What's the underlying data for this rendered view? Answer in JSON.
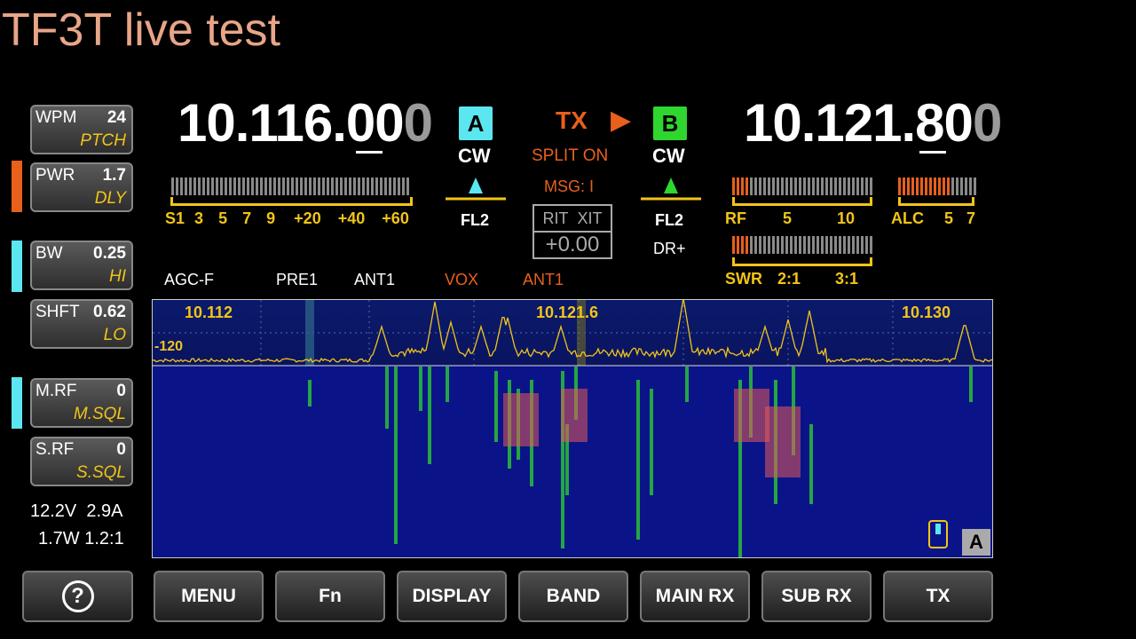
{
  "overlay_title": "TF3T live test",
  "left_panel": {
    "knobs": [
      {
        "label": "WPM",
        "value": "24",
        "sub": "PTCH"
      },
      {
        "label": "PWR",
        "value": "1.7",
        "sub": "DLY"
      },
      {
        "label": "BW",
        "value": "0.25",
        "sub": "HI"
      },
      {
        "label": "SHFT",
        "value": "0.62",
        "sub": "LO"
      },
      {
        "label": "M.RF",
        "value": "0",
        "sub": "M.SQL"
      },
      {
        "label": "S.RF",
        "value": "0",
        "sub": "S.SQL"
      }
    ],
    "indicator_colors": {
      "pwr": "#e8601c",
      "bw": "#5ce6f0",
      "mrf": "#5ce6f0"
    },
    "status_line1": "12.2V  2.9A",
    "status_line2": "1.7W 1.2:1"
  },
  "vfo_a": {
    "freq_main": "10.116.00",
    "freq_tail": "0",
    "badge": "A",
    "badge_color": "#5ce6f0",
    "mode": "CW",
    "filter": "FL2",
    "s_scale": [
      "S1",
      "3",
      "5",
      "7",
      "9",
      "+20",
      "+40",
      "+60"
    ]
  },
  "center": {
    "tx_label": "TX",
    "tx_arrow": "▶",
    "split": "SPLIT ON",
    "msg": "MSG: I",
    "rit": "RIT",
    "xit": "XIT",
    "offset": "+0.00",
    "dr": "DR+"
  },
  "vfo_b": {
    "freq_main": "10.121.80",
    "freq_tail": "0",
    "badge": "B",
    "badge_color": "#2fd62f",
    "mode": "CW",
    "filter": "FL2"
  },
  "meters": {
    "rf_scale": [
      "RF",
      "5",
      "10"
    ],
    "alc_scale": [
      "ALC",
      "5",
      "7"
    ],
    "swr_scale": [
      "SWR",
      "2:1",
      "3:1"
    ]
  },
  "status_row": {
    "agc": "AGC-F",
    "pre": "PRE1",
    "ant_rx": "ANT1",
    "vox": "VOX",
    "ant_tx": "ANT1"
  },
  "scope": {
    "left_freq": "10.112",
    "center_freq": "10.121.6",
    "right_freq": "10.130",
    "ref_level": "-120",
    "badge": "A"
  },
  "buttons": {
    "help": "?",
    "menu": "MENU",
    "fn": "Fn",
    "display": "DISPLAY",
    "band": "BAND",
    "main_rx": "MAIN RX",
    "sub_rx": "SUB RX",
    "tx": "TX"
  }
}
